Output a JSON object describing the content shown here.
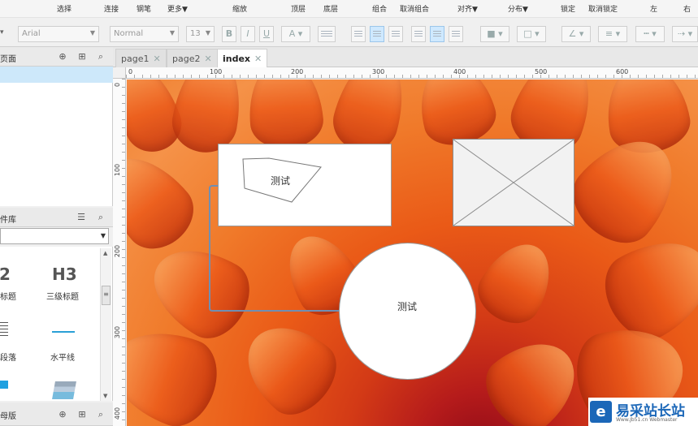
{
  "menubar": {
    "items": [
      "选择",
      "连接",
      "钢笔",
      "更多▼",
      "缩放",
      "顶层",
      "底层",
      "组合",
      "取消组合",
      "对齐▼",
      "分布▼",
      "锁定",
      "取消锁定",
      "左",
      "右"
    ]
  },
  "formatbar": {
    "font_family": "Arial",
    "font_style": "Normal",
    "font_size": "13"
  },
  "pages_panel": {
    "title": "页面"
  },
  "library_panel": {
    "title": "件库",
    "widgets": [
      {
        "glyph": "2",
        "label": "标题"
      },
      {
        "glyph": "H3",
        "label": "三级标题"
      },
      {
        "label": "段落"
      },
      {
        "label": "水平线"
      }
    ]
  },
  "masters_panel": {
    "title": "母版"
  },
  "tabs": [
    {
      "label": "page1",
      "active": false
    },
    {
      "label": "page2",
      "active": false
    },
    {
      "label": "index",
      "active": true
    }
  ],
  "tab_close_glyph": "✕",
  "ruler": {
    "h_ticks": [
      "0",
      "100",
      "200",
      "300",
      "400",
      "500",
      "600"
    ],
    "v_ticks": [
      "0",
      "100",
      "200",
      "300",
      "400"
    ]
  },
  "canvas": {
    "polygon_text": "测试",
    "circle_text": "测试"
  },
  "watermark": {
    "logo_glyph": "e",
    "text": "易采站长站",
    "sub": "Www.Jb51.cn Webmaster"
  },
  "colors": {
    "accent": "#1b67b8",
    "selection": "#cde8fa",
    "connector": "#6f8fb3"
  }
}
